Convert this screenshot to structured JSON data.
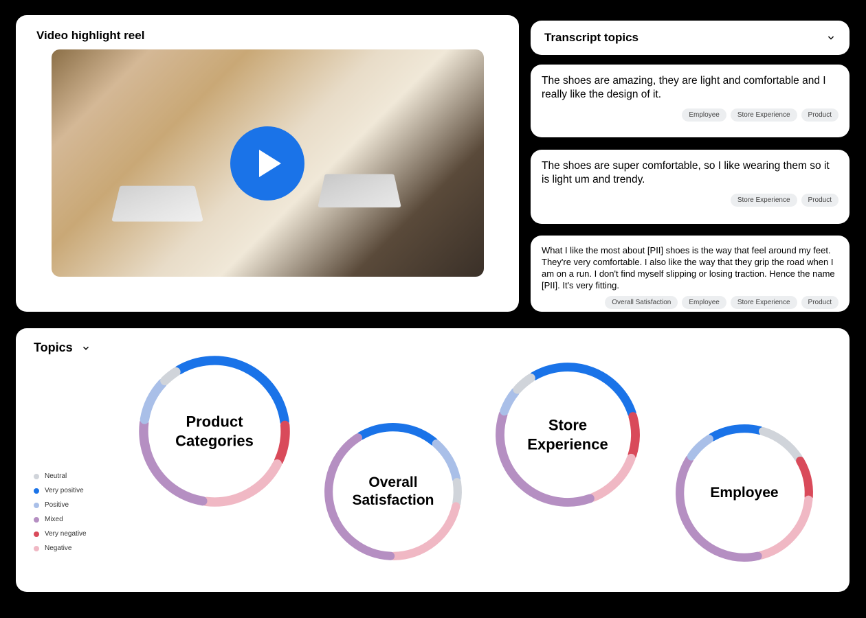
{
  "video": {
    "title": "Video highlight reel"
  },
  "transcript": {
    "header": "Transcript topics",
    "items": [
      {
        "text": "The shoes are amazing, they are light and comfortable and I really like the design of it.",
        "tags": [
          "Employee",
          "Store Experience",
          "Product"
        ]
      },
      {
        "text": "The shoes are super comfortable, so I like wearing them so it is light um and trendy.",
        "tags": [
          "Store Experience",
          "Product"
        ]
      },
      {
        "text": "What I like the most about [PII] shoes is the way that feel around my feet. They're very comfortable. I also like the way that they grip the road when I am on a run. I don't find myself slipping or losing traction. Hence the name [PII]. It's very fitting.",
        "tags": [
          "Overall Satisfaction",
          "Employee",
          "Store Experience",
          "Product"
        ]
      }
    ]
  },
  "topics": {
    "title": "Topics",
    "legend": [
      {
        "label": "Neutral",
        "color": "#d0d4da"
      },
      {
        "label": "Very positive",
        "color": "#1a73e8"
      },
      {
        "label": "Positive",
        "color": "#a9bfe8"
      },
      {
        "label": "Mixed",
        "color": "#b58fc2"
      },
      {
        "label": "Very negative",
        "color": "#d94a5a"
      },
      {
        "label": "Negative",
        "color": "#f0b8c4"
      }
    ]
  },
  "chart_data": [
    {
      "type": "donut",
      "title": "Product Categories",
      "segments": [
        {
          "name": "Very positive",
          "value": 32,
          "color": "#1a73e8"
        },
        {
          "name": "Very negative",
          "value": 9,
          "color": "#d94a5a"
        },
        {
          "name": "Negative",
          "value": 20,
          "color": "#f0b8c4"
        },
        {
          "name": "Mixed",
          "value": 25,
          "color": "#b58fc2"
        },
        {
          "name": "Positive",
          "value": 10,
          "color": "#a9bfe8"
        },
        {
          "name": "Neutral",
          "value": 4,
          "color": "#d0d4da"
        }
      ]
    },
    {
      "type": "donut",
      "title": "Overall Satisfaction",
      "segments": [
        {
          "name": "Very positive",
          "value": 20,
          "color": "#1a73e8"
        },
        {
          "name": "Positive",
          "value": 11,
          "color": "#a9bfe8"
        },
        {
          "name": "Neutral",
          "value": 6,
          "color": "#d0d4da"
        },
        {
          "name": "Negative",
          "value": 22,
          "color": "#f0b8c4"
        },
        {
          "name": "Mixed",
          "value": 41,
          "color": "#b58fc2"
        }
      ]
    },
    {
      "type": "donut",
      "title": "Store Experience",
      "segments": [
        {
          "name": "Very positive",
          "value": 29,
          "color": "#1a73e8"
        },
        {
          "name": "Very negative",
          "value": 10,
          "color": "#d94a5a"
        },
        {
          "name": "Negative",
          "value": 14,
          "color": "#f0b8c4"
        },
        {
          "name": "Mixed",
          "value": 36,
          "color": "#b58fc2"
        },
        {
          "name": "Positive",
          "value": 6,
          "color": "#a9bfe8"
        },
        {
          "name": "Neutral",
          "value": 5,
          "color": "#d0d4da"
        }
      ]
    },
    {
      "type": "donut",
      "title": "Employee",
      "segments": [
        {
          "name": "Very positive",
          "value": 13,
          "color": "#1a73e8"
        },
        {
          "name": "Neutral",
          "value": 12,
          "color": "#d0d4da"
        },
        {
          "name": "Very negative",
          "value": 10,
          "color": "#d94a5a"
        },
        {
          "name": "Negative",
          "value": 20,
          "color": "#f0b8c4"
        },
        {
          "name": "Mixed",
          "value": 38,
          "color": "#b58fc2"
        },
        {
          "name": "Positive",
          "value": 7,
          "color": "#a9bfe8"
        }
      ]
    }
  ]
}
